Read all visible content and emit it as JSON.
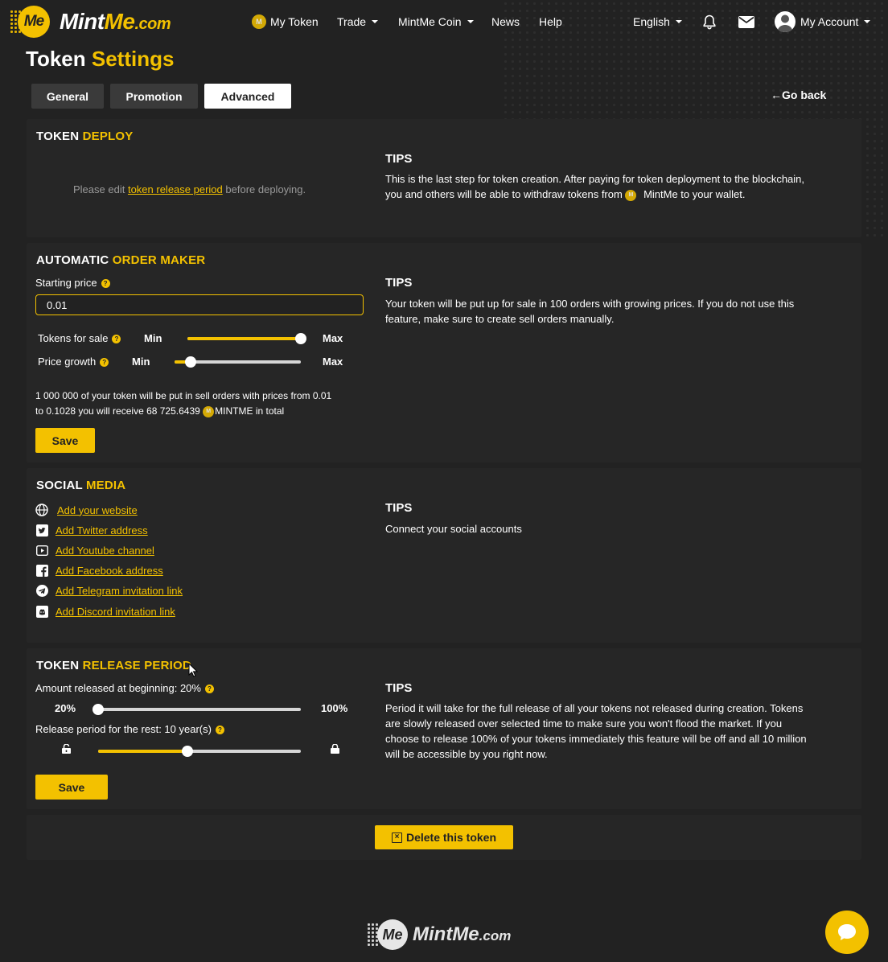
{
  "nav": {
    "brand": {
      "mint": "Mint",
      "me": "Me",
      "com": ".com",
      "badge": "Me"
    },
    "my_token": "My Token",
    "trade": "Trade",
    "mintme_coin": "MintMe Coin",
    "news": "News",
    "help": "Help",
    "language": "English",
    "account": "My Account",
    "icons": [
      "bell-icon",
      "envelope-icon",
      "avatar-icon"
    ]
  },
  "page": {
    "title_a": "Token",
    "title_b": "Settings",
    "tabs": [
      {
        "label": "General"
      },
      {
        "label": "Promotion"
      },
      {
        "label": "Advanced"
      }
    ],
    "active_tab": "Advanced",
    "go_back": "Go back"
  },
  "deploy": {
    "title_a": "TOKEN",
    "title_b": "DEPLOY",
    "msg_pre": "Please edit",
    "msg_link": "token release period",
    "msg_post": "before deploying.",
    "tips_title": "TIPS",
    "tips_line1": "This is the last step for token creation. After paying for token deployment to the blockchain,",
    "tips_line2a": "you and others will be able to withdraw tokens from",
    "tips_line2b": "MintMe to your wallet."
  },
  "order_maker": {
    "title_a": "AUTOMATIC",
    "title_b": "ORDER MAKER",
    "starting_price_label": "Starting price",
    "starting_price_value": "0.01",
    "tokens_for_sale_label": "Tokens for sale",
    "price_growth_label": "Price growth",
    "min": "Min",
    "max": "Max",
    "tokens_for_sale_level": 1.0,
    "price_growth_level": 0.13,
    "summary_line1": "1 000 000 of your token will be put in sell orders with prices from 0.01",
    "summary_line2a": "to 0.1028 you will receive 68 725.6439",
    "summary_line2b": "MINTME in total",
    "save": "Save",
    "tips_title": "TIPS",
    "tips_line1": "Your token will be put up for sale in 100 orders with growing prices. If you do not use this",
    "tips_line2": "feature, make sure to create sell orders manually."
  },
  "social": {
    "title_a": "SOCIAL",
    "title_b": "MEDIA",
    "links": [
      {
        "label": "Add your website",
        "icon": "globe-icon"
      },
      {
        "label": "Add Twitter address",
        "icon": "twitter-icon"
      },
      {
        "label": "Add Youtube channel",
        "icon": "youtube-icon"
      },
      {
        "label": "Add Facebook address",
        "icon": "facebook-icon"
      },
      {
        "label": "Add Telegram invitation link",
        "icon": "telegram-icon"
      },
      {
        "label": "Add Discord invitation link",
        "icon": "discord-icon"
      }
    ],
    "tips_title": "TIPS",
    "tips_text": "Connect your social accounts"
  },
  "release": {
    "title_a": "TOKEN",
    "title_b": "RELEASE PERIOD",
    "amount_label": "Amount released at beginning: 20%",
    "min_pct": "20%",
    "max_pct": "100%",
    "amount_level": 0.0,
    "period_label": "Release period for the rest: 10 year(s)",
    "period_level": 0.44,
    "save": "Save",
    "tips_title": "TIPS",
    "tips_line1": "Period it will take for the full release of all your tokens not released during creation. Tokens",
    "tips_line2": "are slowly released over selected time to make sure you won't flood the market. If you",
    "tips_line3": "choose to release 100% of your tokens immediately this feature will be off and all 10 million",
    "tips_line4": "will be accessible by you right now."
  },
  "delete": {
    "label": "Delete this token"
  },
  "footer": {
    "mint": "Mint",
    "me": "Me",
    "com": ".com",
    "badge": "Me"
  },
  "colors": {
    "accent": "#f3c100",
    "background": "#222222",
    "card": "#262626"
  }
}
